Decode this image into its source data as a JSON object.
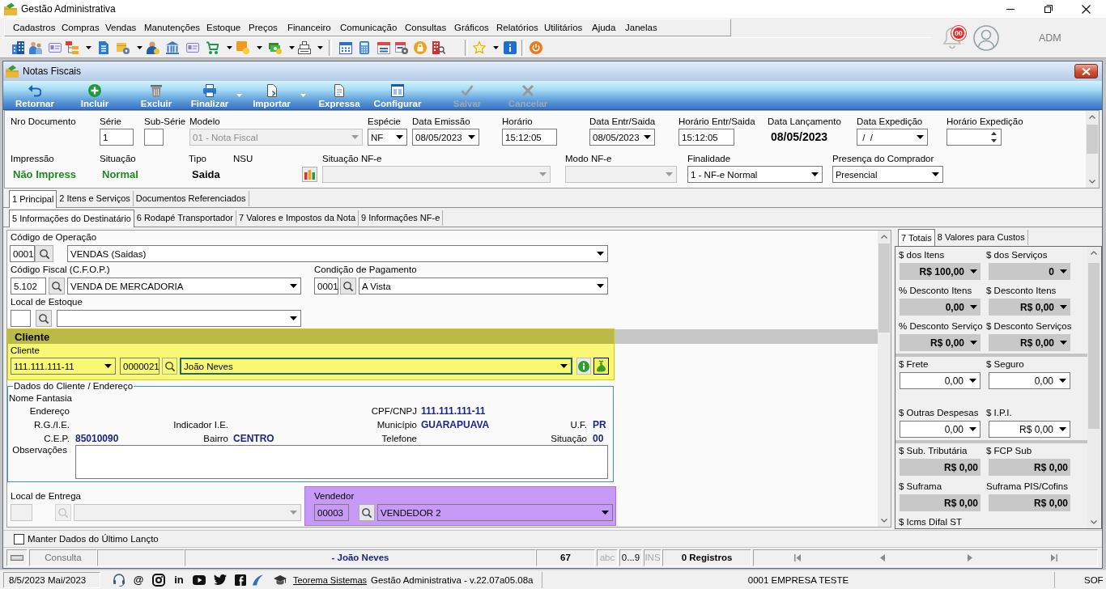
{
  "window": {
    "title": "Gestão Administrativa"
  },
  "menu": [
    "Cadastros",
    "Compras",
    "Vendas",
    "Manutenções",
    "Estoque",
    "Preços",
    "Financeiro",
    "Comunicação",
    "Consultas",
    "Gráficos",
    "Relatórios",
    "Utilitários",
    "Ajuda",
    "Janelas"
  ],
  "user_area": {
    "notification_count": "00",
    "user_name": "ADM"
  },
  "document_window": {
    "title": "Notas Fiscais",
    "actions": [
      {
        "label": "Retornar",
        "disabled": false,
        "dropdown": false
      },
      {
        "label": "Incluir",
        "disabled": false,
        "dropdown": false
      },
      {
        "label": "Excluir",
        "disabled": false,
        "dropdown": false
      },
      {
        "label": "Finalizar",
        "disabled": false,
        "dropdown": true
      },
      {
        "label": "Importar",
        "disabled": false,
        "dropdown": true
      },
      {
        "label": "Expressa",
        "disabled": false,
        "dropdown": false
      },
      {
        "label": "Configurar",
        "disabled": false,
        "dropdown": false
      },
      {
        "label": "Salvar",
        "disabled": true,
        "dropdown": false
      },
      {
        "label": "Cancelar",
        "disabled": true,
        "dropdown": false
      }
    ],
    "header": {
      "row_1": [
        {
          "kind": "label",
          "label": "Nro Documento"
        },
        {
          "kind": "text",
          "label": "Série",
          "value": "1"
        },
        {
          "kind": "text",
          "label": "Sub-Série"
        },
        {
          "kind": "select",
          "label": "Modelo",
          "value": "01 - Nota Fiscal",
          "disabled": true
        },
        {
          "kind": "select",
          "label": "Espécie",
          "value": "NF",
          "disabled": false
        },
        {
          "kind": "select",
          "label": "Data Emissão",
          "value": "08/05/2023",
          "disabled": false
        },
        {
          "kind": "text",
          "label": "Horário",
          "value": "15:12:05"
        },
        {
          "kind": "select",
          "label": "Data Entr/Saida",
          "value": "08/05/2023",
          "disabled": false
        },
        {
          "kind": "text",
          "label": "Horário Entr/Saida",
          "value": "15:12:05"
        },
        {
          "kind": "display",
          "label": "Data Lançamento",
          "value": "08/05/2023"
        },
        {
          "kind": "select",
          "label": "Data Expedição",
          "value": " /  /",
          "disabled": false
        },
        {
          "kind": "spin",
          "label": "Horário Expedição"
        }
      ],
      "row_2": [
        {
          "kind": "status",
          "label": "Impressão",
          "value": "Não Impress"
        },
        {
          "kind": "status",
          "label": "Situação",
          "value": "Normal"
        },
        {
          "kind": "display",
          "label": "Tipo",
          "value": "Saida"
        },
        {
          "kind": "action",
          "label": "NSU"
        },
        {
          "kind": "select",
          "label": "Situação NF-e",
          "disabled": true
        },
        {
          "kind": "select",
          "label": "Modo NF-e",
          "disabled": true
        },
        {
          "kind": "select",
          "label": "Finalidade",
          "value": "1 - NF-e Normal",
          "disabled": false
        },
        {
          "kind": "select",
          "label": "Presença do Comprador",
          "value": "Presencial",
          "disabled": false
        }
      ]
    },
    "tabs": [
      {
        "label": "1 Principal",
        "selected": true
      },
      {
        "label": "2 Itens e Serviços",
        "selected": false
      },
      {
        "label": "Documentos Referenciados",
        "selected": false
      }
    ],
    "subtabs": [
      {
        "label": "5 Informações do Destinatário",
        "selected": true
      },
      {
        "label": "6 Rodapé Transportador",
        "selected": false
      },
      {
        "label": "7 Valores e Impostos da Nota",
        "selected": false
      },
      {
        "label": "9 Informações NF-e",
        "selected": false
      }
    ],
    "recipient": {
      "operation_code": {
        "label": "Código de Operação",
        "code": "0001",
        "value": "VENDAS (Saidas)"
      },
      "fiscal_code": {
        "label": "Código Fiscal (C.F.O.P.)",
        "code": "5.102",
        "value": "VENDA DE MERCADORIA"
      },
      "payment_terms": {
        "label": "Condição de Pagamento",
        "code": "0001",
        "value": "A Vista"
      },
      "stock_location": {
        "label": "Local de Estoque"
      },
      "client": {
        "title": "Cliente",
        "label": "Cliente",
        "document": "111.111.111-11",
        "code": "0000021",
        "name": "João Neves"
      },
      "client_details": {
        "title": "Dados do Cliente / Endereço",
        "fields": [
          {
            "label": "Nome Fantasia"
          },
          {
            "label": "Endereço"
          },
          {
            "label": "CPF/CNPJ",
            "value": "111.111.111-11"
          },
          {
            "label": "R.G./I.E."
          },
          {
            "label": "Indicador I.E."
          },
          {
            "label": "Município",
            "value": "GUARAPUAVA"
          },
          {
            "label": "U.F.",
            "value": "PR"
          },
          {
            "label": "C.E.P.",
            "value": "85010090"
          },
          {
            "label": "Bairro",
            "value": "CENTRO"
          },
          {
            "label": "Telefone"
          },
          {
            "label": "Situação",
            "value": "00"
          }
        ],
        "notes_label": "Observações"
      },
      "delivery_location": {
        "label": "Local de Entrega",
        "disabled": true
      },
      "seller": {
        "label": "Vendedor",
        "code": "00003",
        "value": "VENDEDOR 2"
      }
    },
    "totals": {
      "tabs": [
        {
          "label": "7 Totais",
          "selected": true
        },
        {
          "label": "8 Valores para Custos",
          "selected": false
        }
      ],
      "groups": [
        {
          "fields": [
            {
              "kind": "locked",
              "label": "$ dos Itens",
              "value": "R$ 100,00"
            },
            {
              "kind": "locked",
              "label": "$ dos Serviços",
              "value": "0"
            },
            {
              "kind": "locked",
              "label": "% Desconto Itens",
              "value": "0,00"
            },
            {
              "kind": "locked",
              "label": "$ Desconto Itens",
              "value": "R$ 0,00"
            },
            {
              "kind": "locked",
              "label": "% Desconto Serviço",
              "value": "R$ 0,00"
            },
            {
              "kind": "locked",
              "label": "$ Desconto Serviços",
              "value": "R$ 0,00"
            }
          ]
        },
        {
          "fields": [
            {
              "kind": "editable",
              "label": "$ Frete",
              "value": "0,00"
            },
            {
              "kind": "editable",
              "label": "$ Seguro",
              "value": "0,00"
            },
            {
              "kind": "editable",
              "label": "$ Outras Despesas",
              "value": "0,00"
            },
            {
              "kind": "editable",
              "label": "$ I.P.I.",
              "value": "R$ 0,00"
            }
          ]
        },
        {
          "fields": [
            {
              "kind": "total",
              "label": "$ Sub. Tributária",
              "value": "R$ 0,00"
            },
            {
              "kind": "total",
              "label": "$ FCP Sub",
              "value": "R$ 0,00"
            },
            {
              "kind": "total",
              "label": "$ Suframa",
              "value": "R$ 0,00"
            },
            {
              "kind": "total",
              "label": "Suframa PIS/Cofins",
              "value": "R$ 0,00"
            },
            {
              "kind": "label",
              "label": "$ Icms Difal ST"
            }
          ]
        }
      ]
    },
    "keep_last_entry": {
      "label": "Manter Dados do Último Lançto",
      "checked": false
    },
    "status_bar": {
      "mode": "Consulta",
      "record": "- João Neves",
      "count": "67",
      "indicators": [
        {
          "label": "abc",
          "on": false
        },
        {
          "label": "0...9",
          "on": true
        },
        {
          "label": "INS",
          "on": false
        }
      ],
      "records": "0 Registros"
    }
  },
  "footer": {
    "date": "8/5/2023 Mai/2023",
    "contact_symbols": [
      "@",
      "in"
    ],
    "link": "Teorema Sistemas",
    "version": "Gestão Administrativa - v.22.07a05.08a",
    "company": "0001 EMPRESA TESTE",
    "user": "SOF"
  }
}
